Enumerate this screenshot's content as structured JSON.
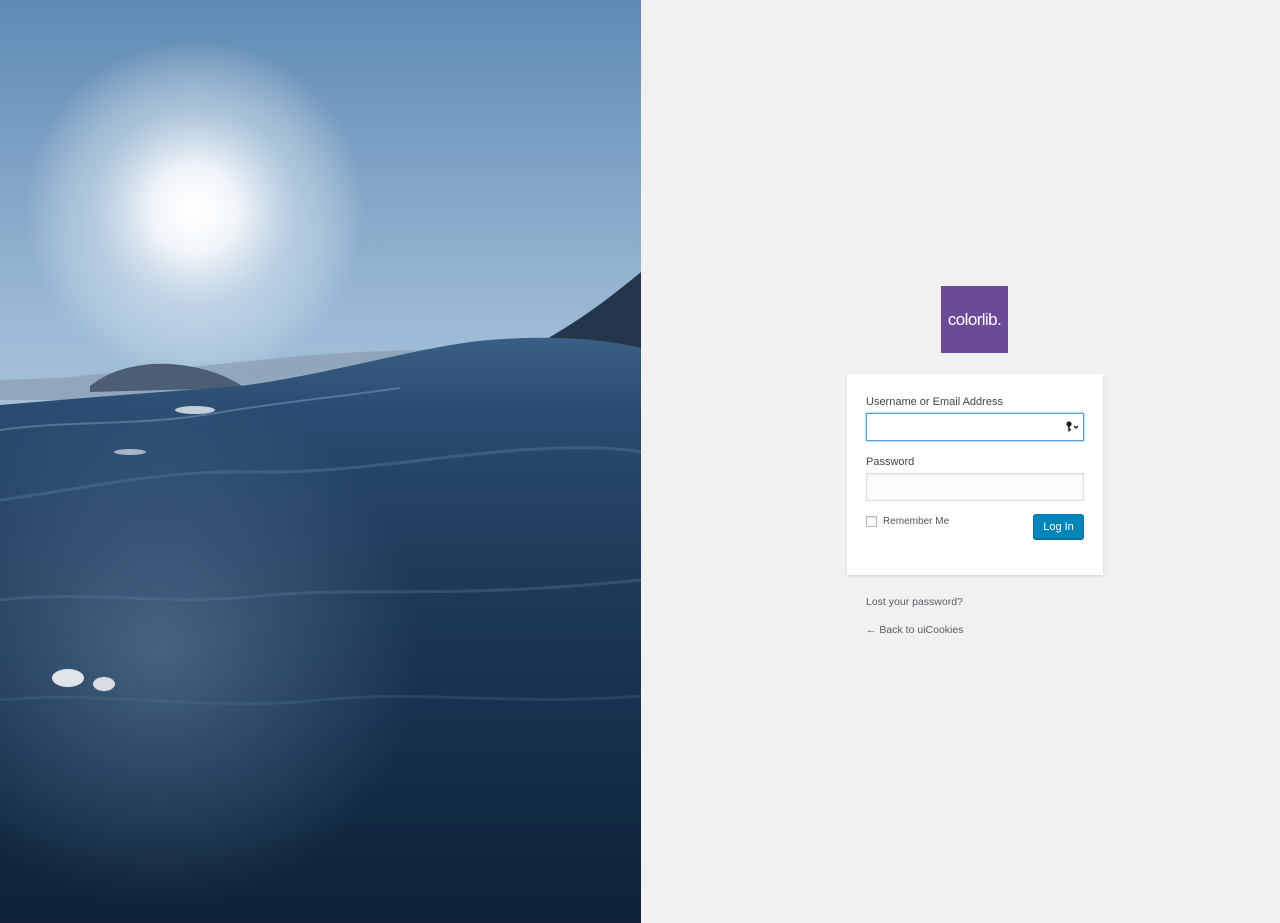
{
  "hero": {
    "description_icon": "ocean-sunset-image"
  },
  "logo": {
    "text": "colorlib.",
    "color": "#6b4a98"
  },
  "login_form": {
    "username_label": "Username or Email Address",
    "username_value": "",
    "password_label": "Password",
    "password_value": "",
    "remember_label": "Remember Me",
    "remember_checked": false,
    "submit_label": "Log In",
    "submit_color": "#0085ba",
    "password_manager_icon": "key-icon"
  },
  "links": {
    "lost_password": "Lost your password?",
    "back_to_site": "← Back to uiCookies"
  }
}
